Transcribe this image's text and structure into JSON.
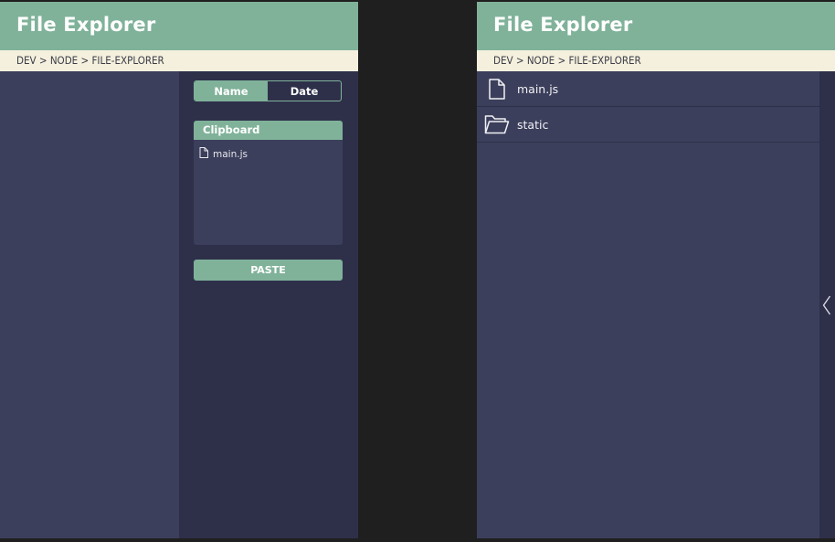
{
  "colors": {
    "accent": "#80b29a",
    "panel_bg": "#3c3f5b",
    "sidebar_bg": "#2e304a",
    "breadcrumb_bg": "#f4f0dd",
    "page_bg": "#1f1f1f"
  },
  "left": {
    "title": "File Explorer",
    "breadcrumb": "DEV > NODE > FILE-EXPLORER",
    "sort": {
      "name_label": "Name",
      "date_label": "Date",
      "active": "Name"
    },
    "clipboard": {
      "title": "Clipboard",
      "items": [
        {
          "icon": "file-icon",
          "name": "main.js"
        }
      ]
    },
    "paste_label": "PASTE"
  },
  "right": {
    "title": "File Explorer",
    "breadcrumb": "DEV > NODE > FILE-EXPLORER",
    "files": [
      {
        "icon": "file-icon",
        "name": "main.js"
      },
      {
        "icon": "folder-icon",
        "name": "static"
      }
    ],
    "rail_icon": "chevron-left-icon"
  }
}
